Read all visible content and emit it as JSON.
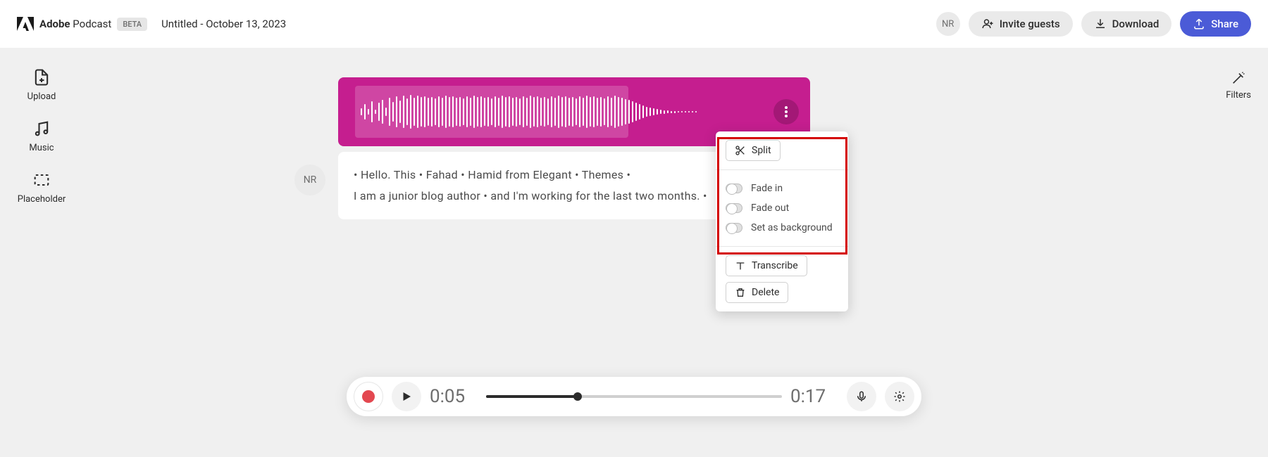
{
  "brand": {
    "name_bold": "Adobe",
    "name_rest": "Podcast",
    "badge": "BETA"
  },
  "title": "Untitled - October 13, 2023",
  "header": {
    "avatar": "NR",
    "invite": "Invite guests",
    "download": "Download",
    "share": "Share"
  },
  "sidebar": {
    "upload": "Upload",
    "music": "Music",
    "placeholder": "Placeholder"
  },
  "filters": "Filters",
  "speaker": "NR",
  "transcript": {
    "line1": "• Hello.   This • Fahad • Hamid   from   Elegant • Themes •",
    "line2": "I   am   a   junior   blog   author • and   I'm   working   for   the   last   two   months. •"
  },
  "ctx": {
    "split": "Split",
    "fadein": "Fade in",
    "fadeout": "Fade out",
    "setbg": "Set as background",
    "transcribe": "Transcribe",
    "delete": "Delete"
  },
  "player": {
    "current": "0:05",
    "total": "0:17"
  }
}
